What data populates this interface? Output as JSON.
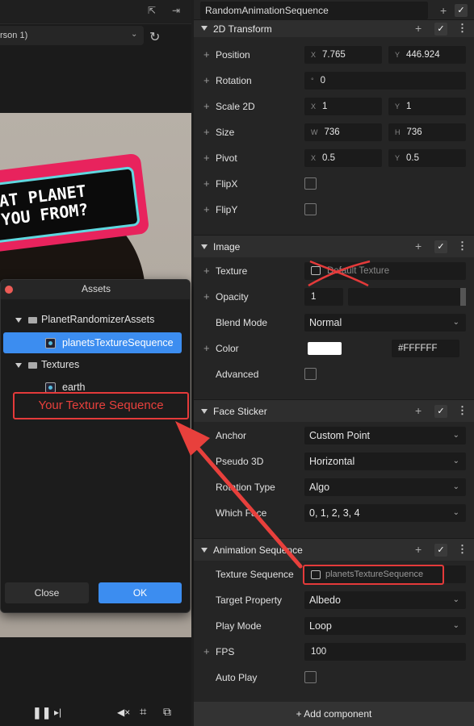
{
  "left": {
    "device_text": "rson 1)",
    "sign_line1": "AT PLANET",
    "sign_line2": "YOU FROM?"
  },
  "assets_dialog": {
    "title": "Assets",
    "tree": [
      {
        "label": "PlanetRandomizerAssets",
        "type": "folder"
      },
      {
        "label": "planetsTextureSequence",
        "type": "texture",
        "selected": true
      },
      {
        "label": "Textures",
        "type": "folder"
      },
      {
        "label": "earth",
        "type": "texture"
      }
    ],
    "callout": "Your Texture Sequence",
    "close_label": "Close",
    "ok_label": "OK"
  },
  "inspector": {
    "object_name": "RandomAnimationSequence",
    "sections": {
      "transform": "2D Transform",
      "image": "Image",
      "face_sticker": "Face Sticker",
      "animation": "Animation Sequence"
    },
    "position": {
      "label": "Position",
      "x": "7.765",
      "y": "446.924"
    },
    "rotation": {
      "label": "Rotation",
      "value": "0"
    },
    "scale": {
      "label": "Scale 2D",
      "x": "1",
      "y": "1"
    },
    "size": {
      "label": "Size",
      "w": "736",
      "h": "736"
    },
    "pivot": {
      "label": "Pivot",
      "x": "0.5",
      "y": "0.5"
    },
    "flipx": "FlipX",
    "flipy": "FlipY",
    "texture": {
      "label": "Texture",
      "value": "Default Texture"
    },
    "opacity": {
      "label": "Opacity",
      "value": "1"
    },
    "blend": {
      "label": "Blend Mode",
      "value": "Normal"
    },
    "color": {
      "label": "Color",
      "hex": "#FFFFFF"
    },
    "advanced": "Advanced",
    "anchor": {
      "label": "Anchor",
      "value": "Custom Point"
    },
    "pseudo3d": {
      "label": "Pseudo 3D",
      "value": "Horizontal"
    },
    "rotation_type": {
      "label": "Rotation Type",
      "value": "Algo"
    },
    "which_face": {
      "label": "Which Face",
      "value": "0, 1, 2, 3, 4"
    },
    "texture_sequence": {
      "label": "Texture Sequence",
      "value": "planetsTextureSequence"
    },
    "target_property": {
      "label": "Target Property",
      "value": "Albedo"
    },
    "play_mode": {
      "label": "Play Mode",
      "value": "Loop"
    },
    "fps": {
      "label": "FPS",
      "value": "100"
    },
    "auto_play": "Auto Play",
    "add_component": "+ Add component"
  },
  "axis_letters": {
    "x": "X",
    "y": "Y",
    "w": "W",
    "h": "H",
    "deg": "°"
  },
  "colors": {
    "accent": "#3c8df0",
    "annotation": "#e43a3a"
  }
}
